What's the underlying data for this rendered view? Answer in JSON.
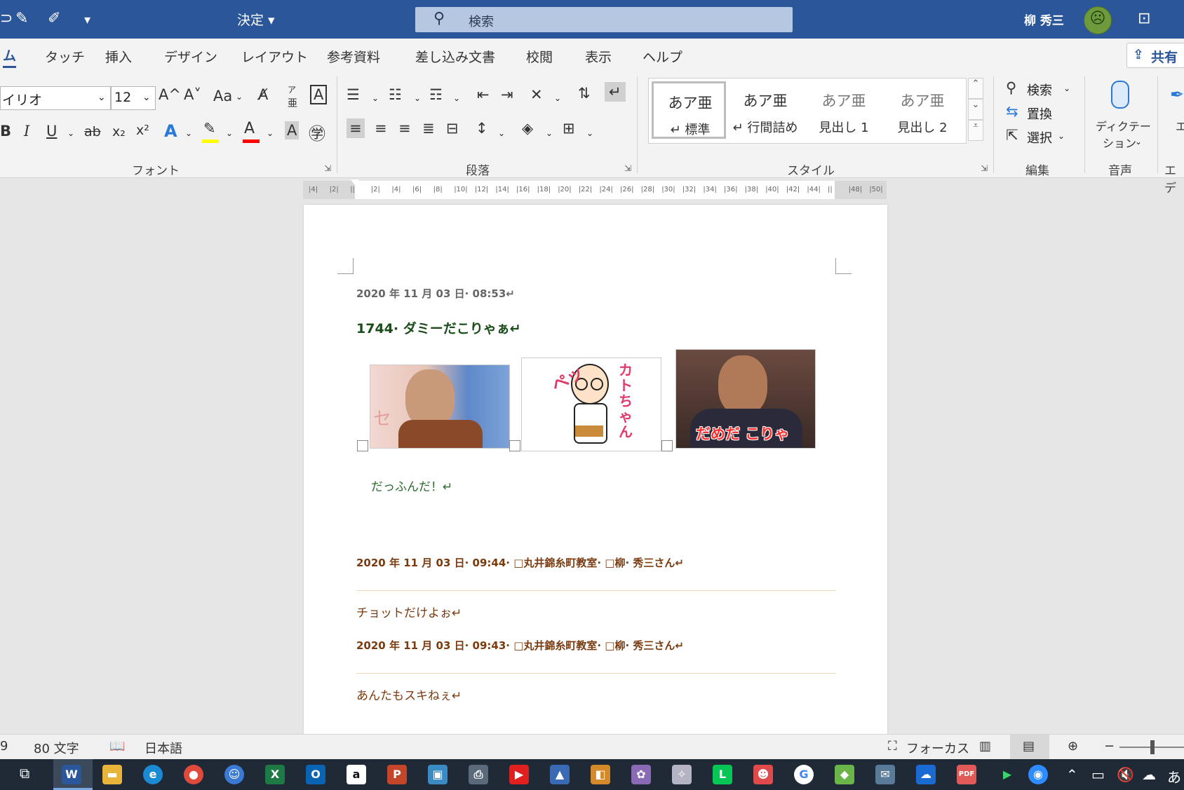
{
  "window": {
    "doc_title": "決定",
    "search_label": "検索",
    "user_name": "柳 秀三"
  },
  "qat": {
    "icons": [
      "edit-icon",
      "touch-mode-icon",
      "customize-dropdown-icon"
    ],
    "glyph_a": "📝",
    "glyph_b": "🖉",
    "glyph_c": "⌄"
  },
  "tabs": {
    "home": "ム",
    "touch": "タッチ",
    "insert": "挿入",
    "design": "デザイン",
    "layout": "レイアウト",
    "references": "参考資料",
    "mailings": "差し込み文書",
    "review": "校閲",
    "view": "表示",
    "help": "ヘルプ",
    "share": "共有"
  },
  "ribbon": {
    "font": {
      "name": "イリオ",
      "size": "12",
      "grow": "A^",
      "shrink": "A˅",
      "case": "Aa",
      "group_label": "フォント",
      "bold": "B",
      "italic": "I",
      "underline": "U",
      "strike": "ab",
      "subscript": "x₂",
      "superscript": "x²",
      "effects": "A",
      "font_color": "A",
      "char_shading": "A",
      "ruby_top": "ア",
      "ruby_bottom": "亜",
      "enclose": "㊫",
      "border": "A",
      "highlight_color": "#ffff00",
      "font_color_value": "#ff0000"
    },
    "paragraph": {
      "group_label": "段落"
    },
    "styles": {
      "group_label": "スタイル",
      "items": [
        {
          "sample": "あア亜",
          "name": "↵ 標準"
        },
        {
          "sample": "あア亜",
          "name": "↵ 行間詰め"
        },
        {
          "sample": "あア亜",
          "name": "見出し 1"
        },
        {
          "sample": "あア亜",
          "name": "見出し 2"
        }
      ]
    },
    "editing": {
      "group_label": "編集",
      "find": "検索",
      "replace": "置換",
      "select": "選択"
    },
    "voice": {
      "group_label": "音声",
      "dictate_1": "ディクテー",
      "dictate_2": "ション"
    },
    "editor": {
      "group_label": "エデ",
      "partial": "エ"
    }
  },
  "ruler": {
    "ticks": [
      "4",
      "2",
      "",
      "2",
      "4",
      "6",
      "8",
      "10",
      "12",
      "14",
      "16",
      "18",
      "20",
      "22",
      "24",
      "26",
      "28",
      "30",
      "32",
      "34",
      "36",
      "38",
      "40",
      "42",
      "44",
      "",
      "48",
      "50"
    ]
  },
  "document": {
    "date1": "2020 年 11 月 03 日· 08:53↵",
    "title": "1744· ダミーだこりゃぁ↵",
    "photo3_caption": "だめだ こりゃ",
    "kato_text": "カトちゃん",
    "pe_text": "ペッ",
    "body1": "だっふんだ！↵",
    "post1_header": "2020 年 11 月 03 日· 09:44· □丸井錦糸町教室· □柳· 秀三さん↵",
    "post1_body": "チョットだけよぉ↵",
    "post2_header": "2020 年 11 月 03 日· 09:43· □丸井錦糸町教室· □柳· 秀三さん↵",
    "post2_body": "あんたもスキねぇ↵",
    "colors": {
      "meta": "#666666",
      "title": "#1a4d1a",
      "body_green": "#2d6a2d",
      "post": "#7a3b10"
    }
  },
  "statusbar": {
    "page_partial": "9",
    "words": "80 文字",
    "language": "日本語",
    "focus": "フォーカス"
  },
  "taskbar": {
    "ime": "あ"
  }
}
